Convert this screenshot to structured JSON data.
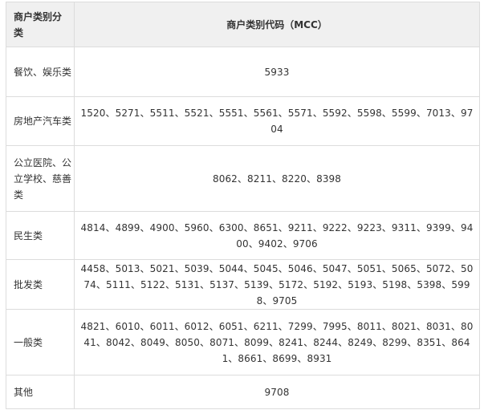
{
  "table": {
    "header": {
      "category": "商户类别分类",
      "code": "商户类别代码（MCC）"
    },
    "rows": [
      {
        "category": "餐饮、娱乐类",
        "codes": "5933"
      },
      {
        "category": "房地产汽车类",
        "codes": "1520、5271、5511、5521、5551、5561、5571、5592、5598、5599、7013、9704"
      },
      {
        "category": "公立医院、公立学校、慈善类",
        "codes": "8062、8211、8220、8398"
      },
      {
        "category": "民生类",
        "codes": "4814、4899、4900、5960、6300、8651、9211、9222、9223、9311、9399、9400、9402、9706"
      },
      {
        "category": "批发类",
        "codes": "4458、5013、5021、5039、5044、5045、5046、5047、5051、5065、5072、5074、5111、5122、5131、5137、5139、5172、5192、5193、5198、5398、5998、9705"
      },
      {
        "category": "一般类",
        "codes": "4821、6010、6011、6012、6051、6211、7299、7995、8011、8021、8031、8041、8042、8049、8050、8071、8099、8241、8244、8249、8299、8351、8641、8661、8699、8931"
      },
      {
        "category": "其他",
        "codes": "9708"
      }
    ]
  },
  "colors": {
    "header_bg": "#f0f0f0",
    "border": "#dcdcdc",
    "text": "#333333"
  }
}
